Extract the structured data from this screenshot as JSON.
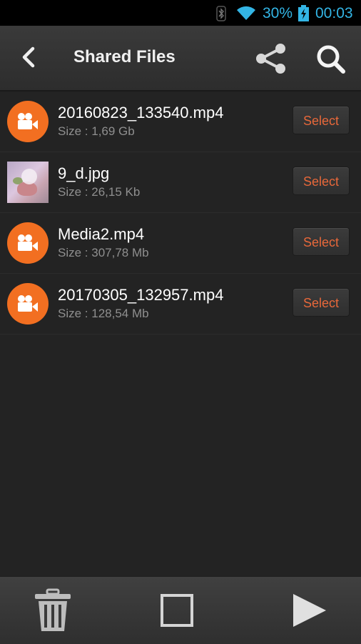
{
  "status_bar": {
    "battery_percent": "30%",
    "clock": "00:03",
    "icons": [
      "bluetooth-icon",
      "wifi-icon",
      "battery-charging-icon"
    ],
    "accent_color": "#33b5e5"
  },
  "action_bar": {
    "title": "Shared Files",
    "icons": [
      "back-icon",
      "share-icon",
      "search-icon"
    ]
  },
  "files": [
    {
      "name": "20160823_133540.mp4",
      "size": "Size : 1,69 Gb",
      "kind": "video",
      "select_label": "Select"
    },
    {
      "name": "9_d.jpg",
      "size": "Size : 26,15 Kb",
      "kind": "image",
      "select_label": "Select"
    },
    {
      "name": "Media2.mp4",
      "size": "Size : 307,78 Mb",
      "kind": "video",
      "select_label": "Select"
    },
    {
      "name": "20170305_132957.mp4",
      "size": "Size : 128,54 Mb",
      "kind": "video",
      "select_label": "Select"
    }
  ],
  "bottom_bar": {
    "icons": [
      "trash-icon",
      "checkbox-icon",
      "play-icon"
    ]
  },
  "colors": {
    "accent_orange": "#f26f21",
    "select_text": "#e8683a",
    "background": "#232323"
  }
}
